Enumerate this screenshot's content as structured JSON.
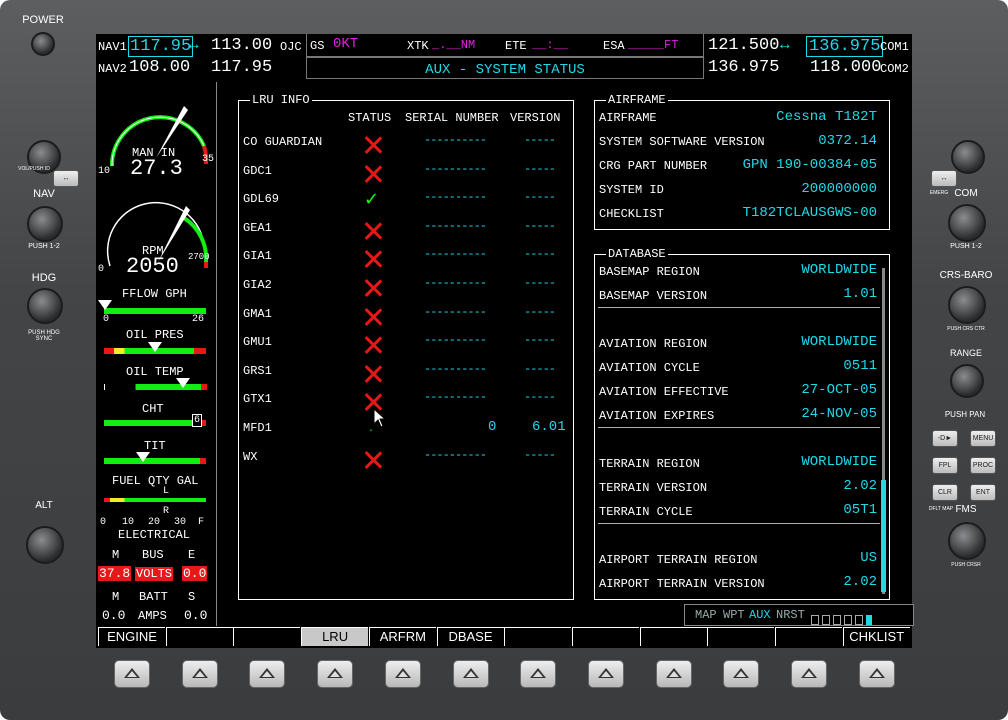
{
  "bezel": {
    "power": "POWER",
    "vol_push": "VOL/PUSH ID",
    "nav": "NAV",
    "push12": "PUSH 1-2",
    "hdg": "HDG",
    "push_hdg": "PUSH HDG SYNC",
    "alt": "ALT",
    "emerg": "EMERG",
    "com": "COM",
    "push12r": "PUSH 1-2",
    "crs_baro": "CRS-BARO",
    "push_crs": "PUSH CRS CTR",
    "range": "RANGE",
    "pan_push": "PUSH PAN",
    "dto": "-D►",
    "menu": "MENU",
    "fpl": "FPL",
    "proc": "PROC",
    "clr": "CLR",
    "ent": "ENT",
    "dflt_map": "DFLT MAP",
    "fms": "FMS",
    "push_crsr": "PUSH CRSR"
  },
  "topbar": {
    "nav1_label": "NAV1",
    "nav1_active": "117.95",
    "nav1_standby": "113.00",
    "nav1_ident": "OJC",
    "nav2_label": "NAV2",
    "nav2_active": "108.00",
    "nav2_standby": "117.95",
    "gs_label": "GS",
    "gs_value": "0KT",
    "xtk_label": "XTK",
    "xtk_value": "_.__NM",
    "ete_label": "ETE",
    "ete_value": "__:__",
    "esa_label": "ESA",
    "esa_value": "_____FT",
    "page_title": "AUX - SYSTEM STATUS",
    "com1_active": "121.500",
    "com1_standby": "136.975",
    "com1_label": "COM1",
    "com2_active": "136.975",
    "com2_standby": "118.000",
    "com2_label": "COM2"
  },
  "eis": {
    "man_in_label": "MAN IN",
    "man_in_value": "27.3",
    "man_min": "10",
    "man_max": "35",
    "rpm_label": "RPM",
    "rpm_value": "2050",
    "rpm_min": "0",
    "rpm_max": "2700",
    "fflow_label": "FFLOW GPH",
    "fflow_min": "0",
    "fflow_max": "26",
    "oil_pres_label": "OIL PRES",
    "oil_temp_label": "OIL TEMP",
    "cht_label": "CHT",
    "cht_cyl": "6",
    "tit_label": "TIT",
    "fuel_label": "FUEL QTY GAL",
    "fuel_ticks": [
      "0",
      "10",
      "20",
      "30",
      "F"
    ],
    "fuel_l": "L",
    "fuel_r": "R",
    "electrical_label": "ELECTRICAL",
    "m1": "M",
    "bus": "BUS",
    "e1": "E",
    "bus_m_value": "37.8",
    "volts": "VOLTS",
    "bus_e_value": "0.0",
    "m2": "M",
    "batt": "BATT",
    "s2": "S",
    "batt_m_value": "0.0",
    "amps": "AMPS",
    "batt_s_value": "0.0"
  },
  "lru": {
    "title": "LRU INFO",
    "headers": {
      "status": "STATUS",
      "serial": "SERIAL NUMBER",
      "version": "VERSION"
    },
    "rows": [
      {
        "name": "CO GUARDIAN",
        "status": "fail",
        "serial": "----------",
        "version": "-----"
      },
      {
        "name": "GDC1",
        "status": "fail",
        "serial": "----------",
        "version": "-----"
      },
      {
        "name": "GDL69",
        "status": "ok",
        "serial": "----------",
        "version": "-----"
      },
      {
        "name": "GEA1",
        "status": "fail",
        "serial": "----------",
        "version": "-----"
      },
      {
        "name": "GIA1",
        "status": "fail",
        "serial": "----------",
        "version": "-----"
      },
      {
        "name": "GIA2",
        "status": "fail",
        "serial": "----------",
        "version": "-----"
      },
      {
        "name": "GMA1",
        "status": "fail",
        "serial": "----------",
        "version": "-----"
      },
      {
        "name": "GMU1",
        "status": "fail",
        "serial": "----------",
        "version": "-----"
      },
      {
        "name": "GRS1",
        "status": "fail",
        "serial": "----------",
        "version": "-----"
      },
      {
        "name": "GTX1",
        "status": "fail",
        "serial": "----------",
        "version": "-----"
      },
      {
        "name": "MFD1",
        "status": "ok-small",
        "serial": "0",
        "version": "6.01"
      },
      {
        "name": "WX",
        "status": "fail",
        "serial": "----------",
        "version": "-----"
      }
    ]
  },
  "airframe": {
    "title": "AIRFRAME",
    "rows": [
      {
        "label": "AIRFRAME",
        "value": "Cessna T182T"
      },
      {
        "label": "SYSTEM SOFTWARE VERSION",
        "value": "0372.14"
      },
      {
        "label": "CRG PART NUMBER",
        "value": "GPN 190-00384-05"
      },
      {
        "label": "SYSTEM ID",
        "value": "200000000"
      },
      {
        "label": "CHECKLIST",
        "value": "T182TCLAUSGWS-00"
      }
    ]
  },
  "database": {
    "title": "DATABASE",
    "groups": [
      [
        {
          "label": "BASEMAP REGION",
          "value": "WORLDWIDE"
        },
        {
          "label": "BASEMAP VERSION",
          "value": "1.01"
        }
      ],
      [
        {
          "label": "AVIATION REGION",
          "value": "WORLDWIDE"
        },
        {
          "label": "AVIATION CYCLE",
          "value": "0511"
        },
        {
          "label": "AVIATION EFFECTIVE",
          "value": "27-OCT-05"
        },
        {
          "label": "AVIATION EXPIRES",
          "value": "24-NOV-05"
        }
      ],
      [
        {
          "label": "TERRAIN REGION",
          "value": "WORLDWIDE"
        },
        {
          "label": "TERRAIN VERSION",
          "value": "2.02"
        },
        {
          "label": "TERRAIN CYCLE",
          "value": "05T1"
        }
      ],
      [
        {
          "label": "AIRPORT TERRAIN REGION",
          "value": "US"
        },
        {
          "label": "AIRPORT TERRAIN VERSION",
          "value": "2.02"
        }
      ]
    ]
  },
  "page_group": {
    "map": "MAP",
    "wpt": "WPT",
    "aux": "AUX",
    "nrst": "NRST"
  },
  "softkeys": [
    "ENGINE",
    "",
    "",
    "LRU",
    "ARFRM",
    "DBASE",
    "",
    "",
    "",
    "",
    "",
    "CHKLIST"
  ],
  "colors": {
    "cyan": "#20d8e8",
    "magenta": "#e020e0",
    "green": "#11ee11",
    "red": "#e81818"
  }
}
